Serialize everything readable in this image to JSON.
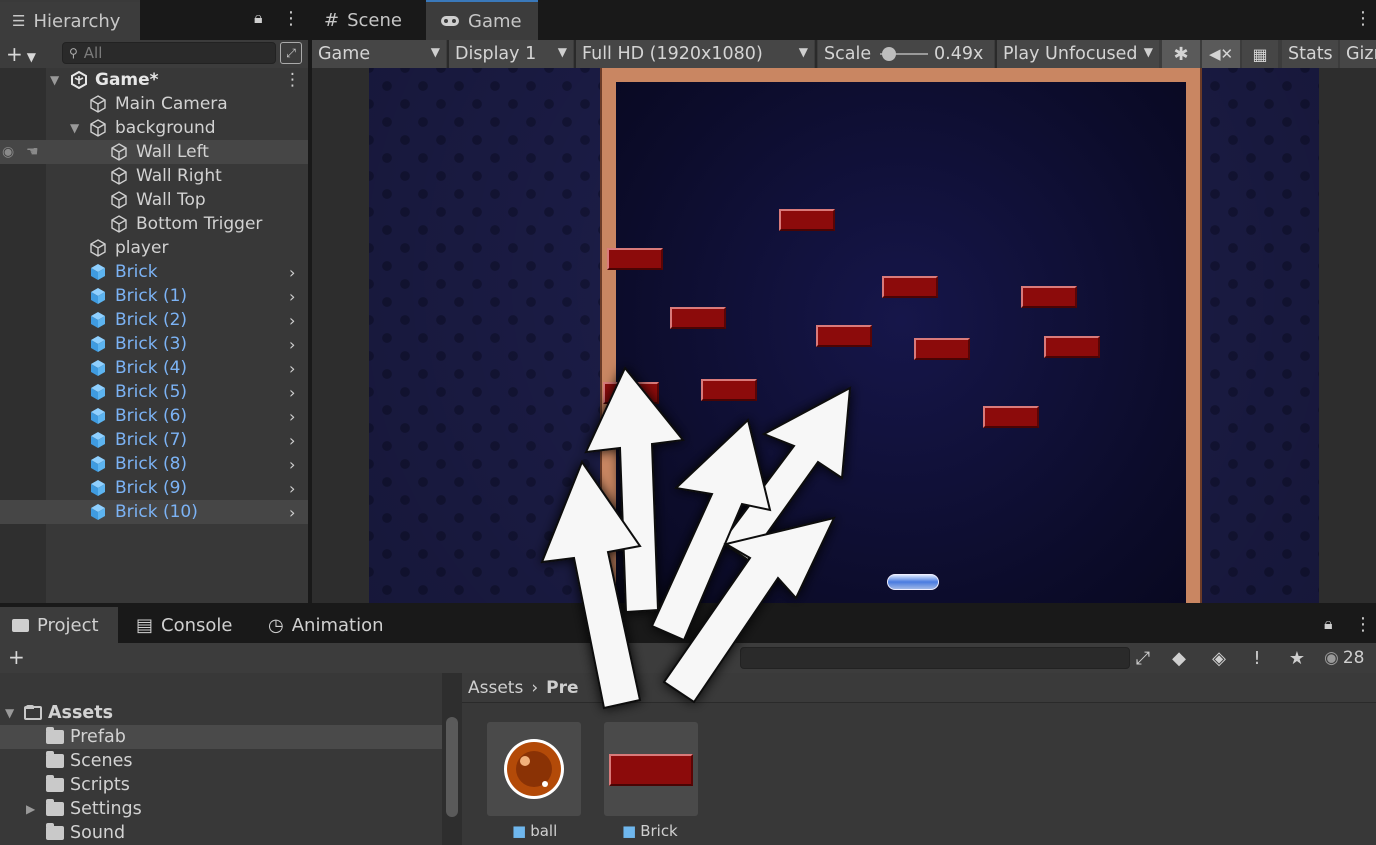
{
  "hierarchy": {
    "tab_label": "Hierarchy",
    "search_placeholder": "All",
    "scene_name": "Game*",
    "items": [
      {
        "label": "Main Camera"
      },
      {
        "label": "background"
      },
      {
        "label": "Wall Left"
      },
      {
        "label": "Wall Right"
      },
      {
        "label": "Wall Top"
      },
      {
        "label": "Bottom Trigger"
      },
      {
        "label": "player"
      },
      {
        "label": "Brick"
      },
      {
        "label": "Brick (1)"
      },
      {
        "label": "Brick (2)"
      },
      {
        "label": "Brick (3)"
      },
      {
        "label": "Brick (4)"
      },
      {
        "label": "Brick (5)"
      },
      {
        "label": "Brick (6)"
      },
      {
        "label": "Brick (7)"
      },
      {
        "label": "Brick (8)"
      },
      {
        "label": "Brick (9)"
      },
      {
        "label": "Brick (10)"
      }
    ]
  },
  "tabs": {
    "scene": "Scene",
    "game": "Game"
  },
  "game_toolbar": {
    "mode": "Game",
    "display": "Display 1",
    "resolution": "Full HD (1920x1080)",
    "scale_label": "Scale",
    "scale_value": "0.49x",
    "play_mode": "Play Unfocused",
    "stats": "Stats",
    "gizmos": "Gizm"
  },
  "bottom_tabs": {
    "project": "Project",
    "console": "Console",
    "animation": "Animation"
  },
  "project": {
    "folders": [
      {
        "label": "Assets"
      },
      {
        "label": "Prefab"
      },
      {
        "label": "Scenes"
      },
      {
        "label": "Scripts"
      },
      {
        "label": "Settings"
      },
      {
        "label": "Sound"
      }
    ],
    "breadcrumb": [
      "Assets",
      "Pre"
    ],
    "assets": [
      {
        "label": "ball"
      },
      {
        "label": "Brick"
      }
    ],
    "visible_count": "28"
  },
  "colors": {
    "accent_blue": "#7cb3f5",
    "brick_red": "#8c0b0b",
    "frame_copper": "#c98662",
    "panel_bg": "#383838"
  },
  "icons": [
    "hierarchy-icon",
    "grid-icon",
    "gamepad-icon",
    "unity-scene-icon",
    "gameobject-icon",
    "prefab-icon",
    "folder-icon",
    "lock-icon",
    "kebab-menu-icon",
    "bug-icon",
    "mute-icon",
    "keyboard-icon",
    "eye-icon",
    "star-icon",
    "tag-icon",
    "warning-icon"
  ]
}
